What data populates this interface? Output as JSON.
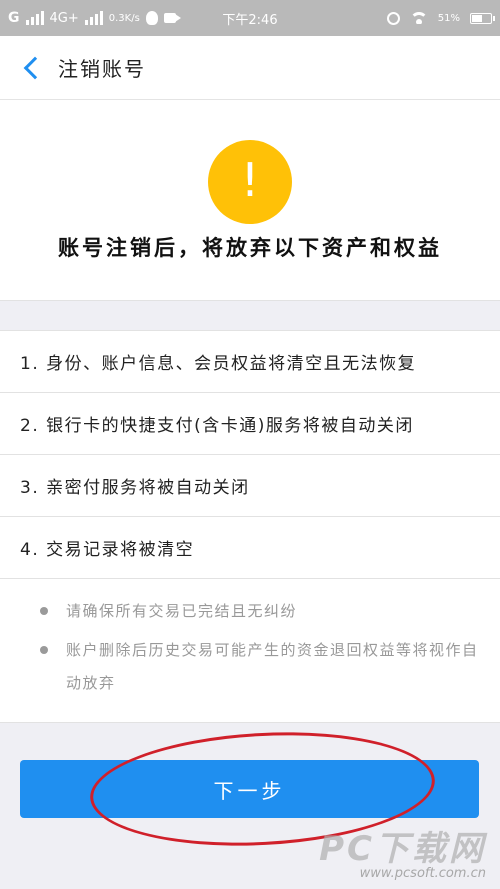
{
  "status_bar": {
    "carrier": "G",
    "network": "4G+",
    "speed": "0.3K/s",
    "time": "下午2:46",
    "battery": "51%"
  },
  "nav": {
    "title": "注销账号"
  },
  "hero": {
    "warn_symbol": "!",
    "title": "账号注销后，将放弃以下资产和权益"
  },
  "rights": [
    "1. 身份、账户信息、会员权益将清空且无法恢复",
    "2. 银行卡的快捷支付(含卡通)服务将被自动关闭",
    "3. 亲密付服务将被自动关闭",
    "4. 交易记录将被清空"
  ],
  "notes": [
    "请确保所有交易已完结且无纠纷",
    "账户删除后历史交易可能产生的资金退回权益等将视作自动放弃"
  ],
  "next_button": {
    "label": "下一步"
  },
  "watermark": {
    "brand": "PC下载网",
    "url": "www.pcsoft.com.cn"
  },
  "colors": {
    "accent": "#1f8ff0",
    "warning": "#ffc107",
    "annotation": "#d0202a"
  }
}
